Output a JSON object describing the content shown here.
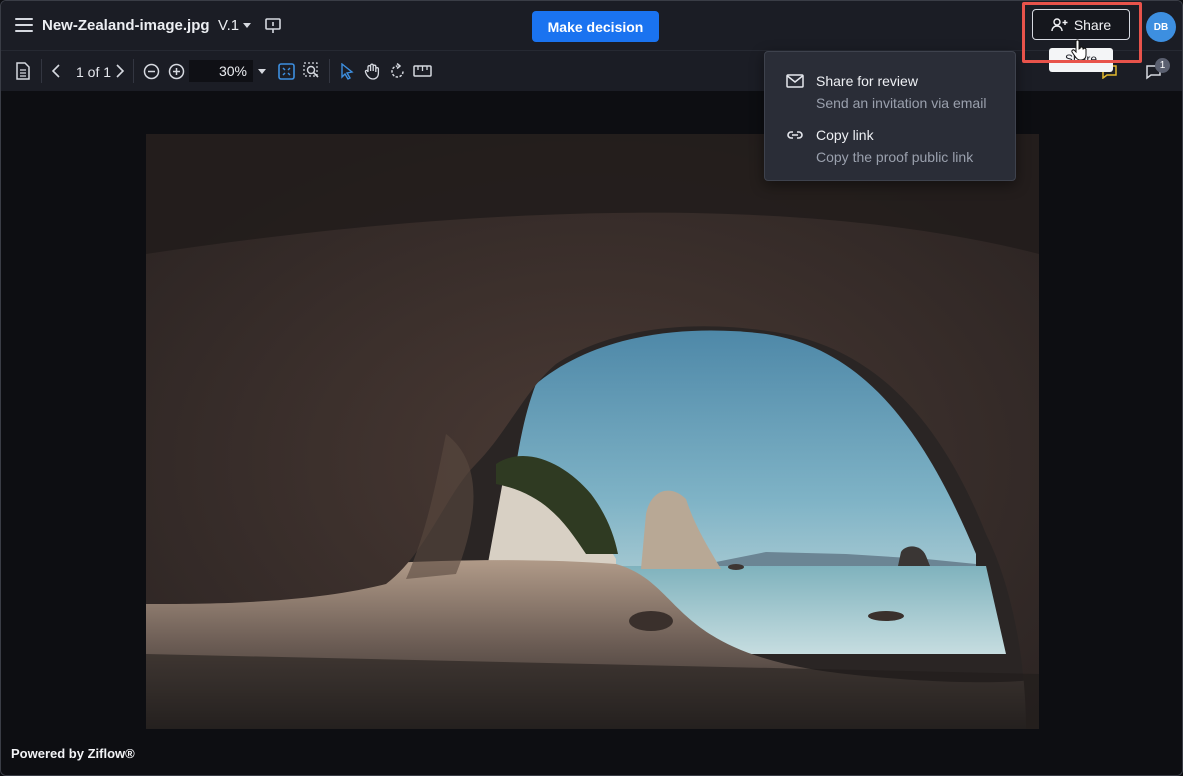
{
  "header": {
    "file_name": "New-Zealand-image.jpg",
    "version_label": "V.1",
    "make_decision_label": "Make decision",
    "share_label": "Share",
    "share_tooltip": "Share",
    "avatar_initials": "DB"
  },
  "toolbar": {
    "page_indicator": "1 of 1",
    "zoom_value": "30%",
    "comment_count": "1"
  },
  "share_menu": {
    "items": [
      {
        "title": "Share for review",
        "subtitle": "Send an invitation via email",
        "icon": "mail-icon"
      },
      {
        "title": "Copy link",
        "subtitle": "Copy the proof public link",
        "icon": "link-icon"
      }
    ]
  },
  "footer": {
    "powered_by": "Powered by Ziflow®"
  },
  "colors": {
    "accent": "#1a73f0",
    "highlight": "#e8534b",
    "avatar": "#3d8fe0",
    "bar_bg": "#1b1d25",
    "canvas_bg": "#0d0e12"
  }
}
